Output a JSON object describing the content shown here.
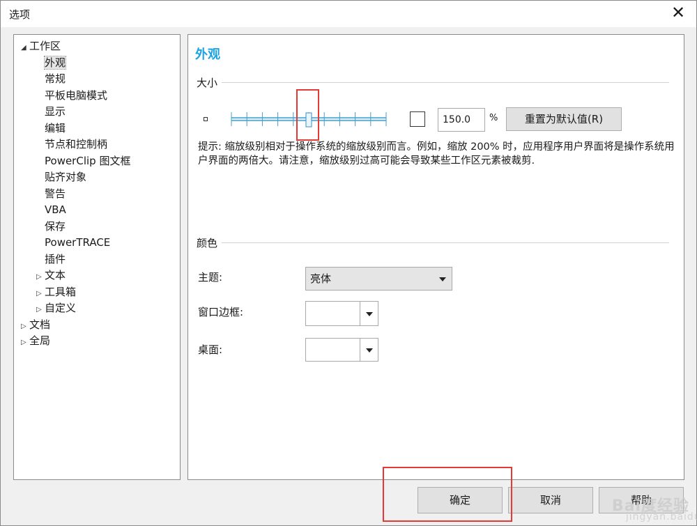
{
  "window": {
    "title": "选项"
  },
  "tree": {
    "items": [
      {
        "label": "工作区",
        "arrow": "◢",
        "level": 0
      },
      {
        "label": "外观",
        "arrow": "",
        "level": 1,
        "selected": true
      },
      {
        "label": "常规",
        "arrow": "",
        "level": 1
      },
      {
        "label": "平板电脑模式",
        "arrow": "",
        "level": 1
      },
      {
        "label": "显示",
        "arrow": "",
        "level": 1
      },
      {
        "label": "编辑",
        "arrow": "",
        "level": 1
      },
      {
        "label": "节点和控制柄",
        "arrow": "",
        "level": 1
      },
      {
        "label": "PowerClip 图文框",
        "arrow": "",
        "level": 1
      },
      {
        "label": "贴齐对象",
        "arrow": "",
        "level": 1
      },
      {
        "label": "警告",
        "arrow": "",
        "level": 1
      },
      {
        "label": "VBA",
        "arrow": "",
        "level": 1
      },
      {
        "label": "保存",
        "arrow": "",
        "level": 1
      },
      {
        "label": "PowerTRACE",
        "arrow": "",
        "level": 1
      },
      {
        "label": "插件",
        "arrow": "",
        "level": 1
      },
      {
        "label": "文本",
        "arrow": "▷",
        "level": 1
      },
      {
        "label": "工具箱",
        "arrow": "▷",
        "level": 1
      },
      {
        "label": "自定义",
        "arrow": "▷",
        "level": 1
      },
      {
        "label": "文档",
        "arrow": "▷",
        "level": 0
      },
      {
        "label": "全局",
        "arrow": "▷",
        "level": 0
      }
    ]
  },
  "content": {
    "heading": "外观",
    "size_group": "大小",
    "slider_value": 0.5,
    "checkbox_checked": false,
    "scale_value": "150.0",
    "scale_unit": "%",
    "reset_button": "重置为默认值(R)",
    "hint_text": "提示: 缩放级别相对于操作系统的缩放级别而言。例如，缩放 200% 时，应用程序用户界面将是操作系统用户界面的两倍大。请注意，缩放级别过高可能会导致某些工作区元素被裁剪.",
    "color_group": "颜色",
    "theme_label": "主题:",
    "theme_value": "亮体",
    "window_border_label": "窗口边框:",
    "window_border_value": "",
    "desktop_label": "桌面:",
    "desktop_value": ""
  },
  "buttons": {
    "ok": "确定",
    "cancel": "取消",
    "help": "帮助"
  },
  "watermark": {
    "main": "Bai度经验",
    "sub": "jingyan.baidu.com"
  },
  "colors": {
    "heading": "#1aa3e8",
    "highlight_box": "#e53935"
  }
}
